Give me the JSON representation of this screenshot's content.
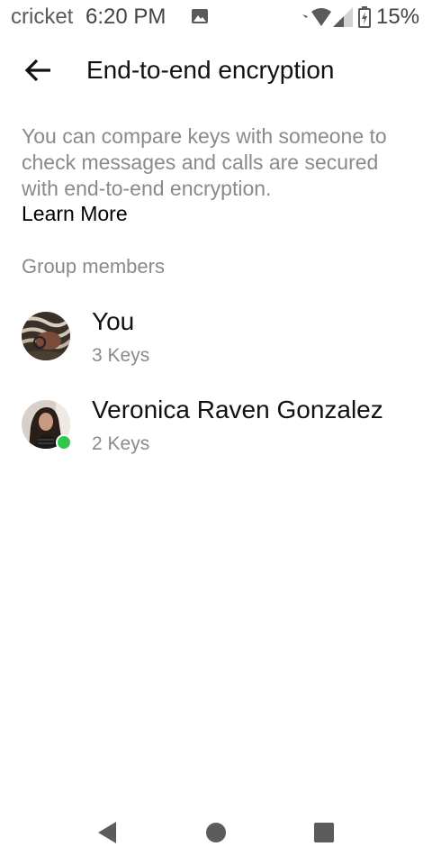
{
  "status_bar": {
    "carrier": "cricket",
    "time": "6:20 PM",
    "battery_percent": "15%",
    "icons": [
      "image-icon",
      "wifi-icon",
      "signal-icon",
      "battery-icon"
    ]
  },
  "app_bar": {
    "title": "End-to-end encryption",
    "back_icon": "arrow-left-icon"
  },
  "description": {
    "text": "You can compare keys with someone to check messages and calls are secured with end-to-end encryption.",
    "learn_more": "Learn More"
  },
  "section": {
    "header": "Group members"
  },
  "members": [
    {
      "name": "You",
      "keys": "3 Keys",
      "online": false
    },
    {
      "name": "Veronica Raven Gonzalez",
      "keys": "2 Keys",
      "online": true
    }
  ],
  "colors": {
    "online": "#31c84a",
    "secondary_text": "#8a8a8a",
    "primary_text": "#111111"
  },
  "nav_bar": {
    "icons": [
      "back-triangle-icon",
      "home-circle-icon",
      "recents-square-icon"
    ]
  }
}
